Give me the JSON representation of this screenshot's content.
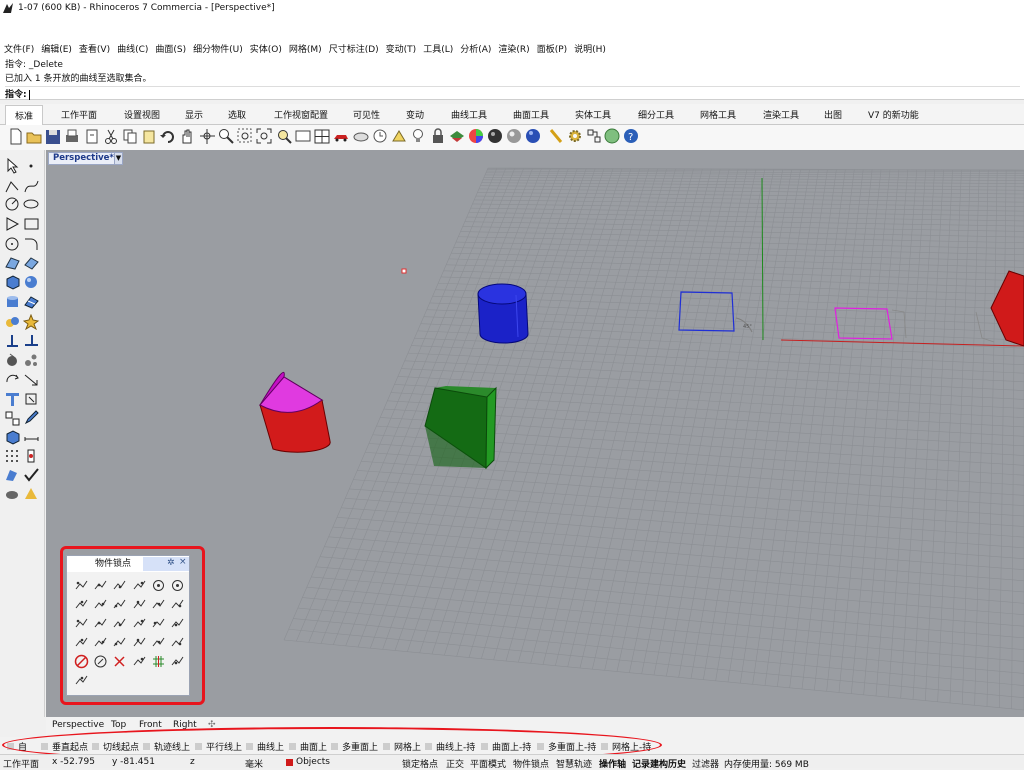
{
  "window": {
    "title": "1-07 (600 KB) - Rhinoceros 7 Commercia - [Perspective*]"
  },
  "menu": [
    "文件(F)",
    "编辑(E)",
    "查看(V)",
    "曲线(C)",
    "曲面(S)",
    "细分物件(U)",
    "实体(O)",
    "网格(M)",
    "尺寸标注(D)",
    "变动(T)",
    "工具(L)",
    "分析(A)",
    "渲染(R)",
    "面板(P)",
    "说明(H)"
  ],
  "command": {
    "history1": "指令: _Delete",
    "history2": "已加入 1 条开放的曲线至选取集合。",
    "prompt": "指令:"
  },
  "tabs": [
    "标准",
    "工作平面",
    "设置视图",
    "显示",
    "选取",
    "工作视窗配置",
    "可见性",
    "变动",
    "曲线工具",
    "曲面工具",
    "实体工具",
    "细分工具",
    "网格工具",
    "渲染工具",
    "出图",
    "V7 的新功能"
  ],
  "viewport": {
    "label": "Perspective*",
    "dropdown": "▼"
  },
  "osnap_panel": {
    "title": "物件锁点",
    "gear": "✲",
    "close": "×",
    "back": "←"
  },
  "viewport_tabs": [
    "Perspective",
    "Top",
    "Front",
    "Right",
    "✣"
  ],
  "snaps": [
    "自",
    "垂直起点",
    "切线起点",
    "轨迹线上",
    "平行线上",
    "曲线上",
    "曲面上",
    "多重面上",
    "网格上",
    "曲线上-持",
    "曲面上-持",
    "多重面上-持",
    "网格上-持"
  ],
  "status": {
    "cplane": "工作平面",
    "x": "x -52.795",
    "y": "y -81.451",
    "z": "z",
    "units": "毫米",
    "layer": "Objects",
    "modes": [
      "锁定格点",
      "正交",
      "平面模式",
      "物件锁点",
      "智慧轨迹",
      "操作轴",
      "记录建构历史",
      "过滤器",
      "内存使用量: 569 MB"
    ]
  },
  "colors": {
    "red_highlight": "#e8151d",
    "viewport_bg": "#9a9da2",
    "grid": "#8c8f94",
    "x_axis": "#c62020",
    "y_axis": "#1d8a1d"
  }
}
